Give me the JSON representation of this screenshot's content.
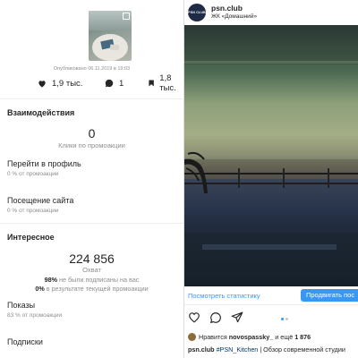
{
  "left": {
    "published": "Опубликовано 06.11.2019 в 19:03",
    "stats": {
      "likes": "1,9 тыс.",
      "comments": "1",
      "saves": "1,8 тыс."
    },
    "interactions": {
      "title": "Взаимодействия",
      "clicks_value": "0",
      "clicks_label": "Клики по промоакции",
      "profile_label": "Перейти в профиль",
      "profile_sub": "0 % от промоакции",
      "site_label": "Посещение сайта",
      "site_sub": "0 % от промоакции"
    },
    "discovery": {
      "title": "Интересное",
      "reach_value": "224 856",
      "reach_label": "Охват",
      "not_following_pct": "98%",
      "not_following_text": "не были подписаны на вас",
      "from_promo_pct": "0%",
      "from_promo_text": "в результате текущей промоакции",
      "impressions_label": "Показы",
      "impressions_sub": "83 % от промоакции",
      "follows_label": "Подписки"
    }
  },
  "right": {
    "account_name": "psn.club",
    "avatar_text": "PSN CLUB",
    "location": "ЖК «Домашний»",
    "see_stats": "Посмотреть статистику",
    "promote": "Продвигать пос",
    "liked_prefix": "Нравится",
    "liked_user": "novospassky_",
    "liked_suffix": "и ещё",
    "liked_count": "1 876",
    "caption_user": "psn.club",
    "caption_tag": "#PSN_Kitchen",
    "caption_text": "| Обзор современной студии",
    "icons": [
      "heart-icon",
      "comment-icon",
      "share-icon"
    ],
    "carousel_active_index": 0
  },
  "colors": {
    "accent": "#3897f0",
    "muted": "#8e8e8e",
    "text": "#262626"
  }
}
